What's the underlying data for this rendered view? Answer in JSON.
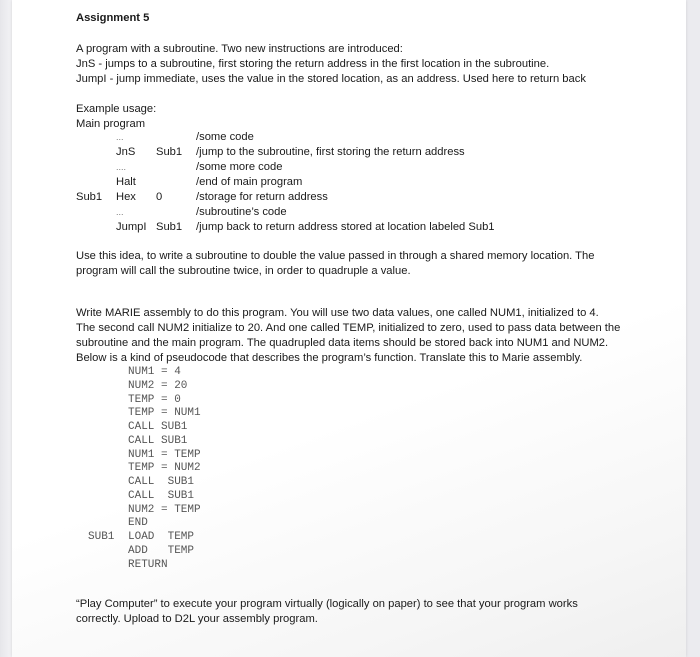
{
  "document": {
    "title": "Assignment 5",
    "intro": [
      "A program with a subroutine.  Two new instructions are introduced:",
      "JnS  - jumps to a subroutine, first storing the return address in the first location in the subroutine.",
      "JumpI   - jump immediate, uses the value in the stored location, as an address.  Used here to return back"
    ],
    "example_heading": "Example usage:",
    "main_program_label": "Main program",
    "example_code": [
      {
        "label": "",
        "op": "...",
        "arg": "",
        "comment": "/some code"
      },
      {
        "label": "",
        "op": "JnS",
        "arg": "Sub1",
        "comment": "/jump to the subroutine, first storing the return address"
      },
      {
        "label": "",
        "op": "....",
        "arg": "",
        "comment": "/some more code"
      },
      {
        "label": "",
        "op": "Halt",
        "arg": "",
        "comment": "/end of main program"
      },
      {
        "label": "Sub1",
        "op": "Hex",
        "arg": "0",
        "comment": "/storage for return address"
      },
      {
        "label": "",
        "op": "...",
        "arg": "",
        "comment": "/subroutine’s code"
      },
      {
        "label": "",
        "op": "JumpI",
        "arg": "Sub1",
        "comment": "/jump back to return address stored at location labeled Sub1"
      }
    ],
    "use_paragraph": [
      "Use this idea, to write a subroutine to double the value passed in through a shared memory location.  The",
      "program will call the subroutine twice, in order to quadruple a value."
    ],
    "write_paragraph": [
      "Write MARIE assembly to do this program.  You will use two data values, one called NUM1, initialized to 4.",
      "The second call NUM2 initialize to 20.  And one called TEMP, initialized to zero, used to pass data between the",
      "subroutine and the main program.  The quadrupled data items should be stored back into NUM1 and NUM2.",
      "Below is a kind of pseudocode that describes the program’s function.  Translate this to Marie assembly."
    ],
    "pseudocode": [
      {
        "label": "",
        "code": "NUM1 = 4"
      },
      {
        "label": "",
        "code": "NUM2 = 20"
      },
      {
        "label": "",
        "code": "TEMP = 0"
      },
      {
        "label": "",
        "code": "TEMP = NUM1"
      },
      {
        "label": "",
        "code": "CALL SUB1"
      },
      {
        "label": "",
        "code": "CALL SUB1"
      },
      {
        "label": "",
        "code": "NUM1 = TEMP"
      },
      {
        "label": "",
        "code": "TEMP = NUM2"
      },
      {
        "label": "",
        "code": "CALL  SUB1"
      },
      {
        "label": "",
        "code": "CALL  SUB1"
      },
      {
        "label": "",
        "code": "NUM2 = TEMP"
      },
      {
        "label": "",
        "code": "END"
      },
      {
        "label": "SUB1",
        "code": "LOAD  TEMP"
      },
      {
        "label": "",
        "code": "ADD   TEMP"
      },
      {
        "label": "",
        "code": "RETURN"
      }
    ],
    "play_paragraph": [
      "“Play Computer” to execute your program virtually (logically on paper) to see that your program works",
      "correctly.  Upload to D2L your assembly program."
    ]
  }
}
